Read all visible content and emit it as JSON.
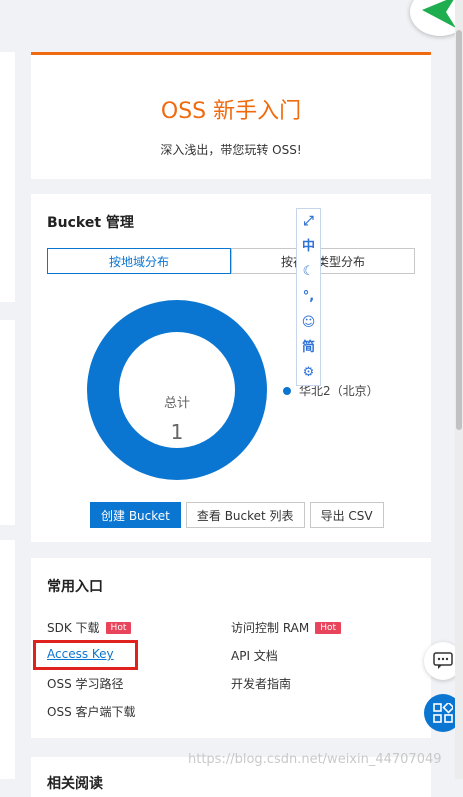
{
  "intro": {
    "title": "OSS 新手入门",
    "subtitle": "深入浅出，带您玩转 OSS!"
  },
  "bucket": {
    "title": "Bucket 管理",
    "tabs": [
      {
        "label": "按地域分布",
        "active": true
      },
      {
        "label": "按存储类型分布",
        "active": false
      }
    ],
    "chart_data": {
      "type": "pie",
      "center_label": "总计",
      "center_value": "1",
      "slices": [
        {
          "name": "华北2（北京）",
          "value": 1
        }
      ],
      "colors": [
        "#0b76d1"
      ]
    },
    "buttons": {
      "create": "创建 Bucket",
      "list": "查看 Bucket 列表",
      "export": "导出 CSV"
    }
  },
  "toolbar": {
    "items": [
      "⤢",
      "中",
      "☾",
      "°,",
      "☺",
      "简",
      "⚙"
    ],
    "icons": [
      "expand-icon",
      "chinese-icon",
      "moon-icon",
      "punctuation-icon",
      "user-icon",
      "simplified-icon",
      "gear-icon"
    ]
  },
  "entries": {
    "title": "常用入口",
    "sdk": "SDK 下载",
    "sdk_hot": "Hot",
    "ram": "访问控制 RAM",
    "ram_hot": "Hot",
    "access_key": "Access Key",
    "api_doc": "API 文档",
    "learning_path": "OSS 学习路径",
    "developer_guide": "开发者指南",
    "client_download": "OSS 客户端下载"
  },
  "bottom": {
    "title": "相关阅读"
  },
  "watermark": "https://blog.csdn.net/weixin_44707049",
  "colors": {
    "brand_orange": "#f06a0f",
    "primary_blue": "#0b76d1",
    "hot_red": "#e8445b",
    "highlight_red": "#e0221e"
  }
}
